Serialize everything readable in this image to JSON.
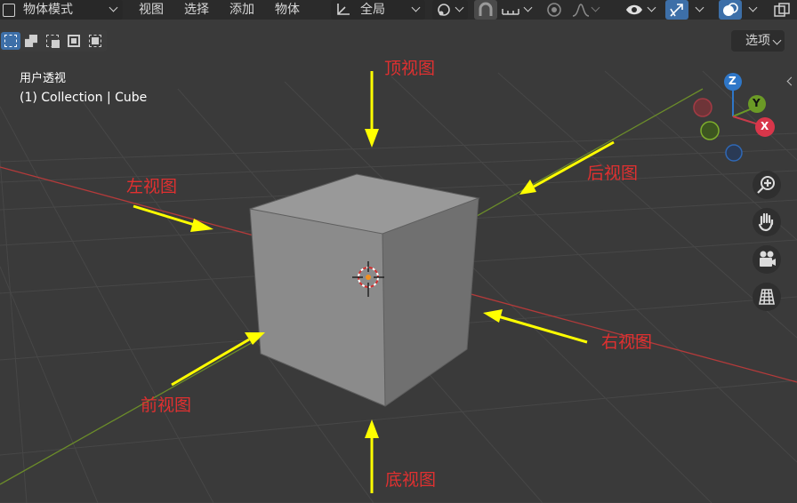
{
  "header": {
    "mode_label": "物体模式",
    "menu": [
      "视图",
      "选择",
      "添加",
      "物体"
    ],
    "orientation_label": "全局",
    "options_label": "选项"
  },
  "overlay": {
    "view_name": "用户透视",
    "collection_label": "(1) Collection | Cube"
  },
  "gizmo": {
    "x_label": "X",
    "y_label": "Y",
    "z_label": "Z"
  },
  "annotations": {
    "top": "顶视图",
    "back": "后视图",
    "left": "左视图",
    "right": "右视图",
    "front": "前视图",
    "bottom": "底视图"
  },
  "colors": {
    "background": "#3a3a3a",
    "x_axis": "#b43a3a",
    "y_axis": "#6b8c2a",
    "annotation_text": "#e03030",
    "arrow": "#ffff00",
    "selected_button": "#3d6fa8"
  },
  "icons": [
    "object-mode-icon",
    "transform-pivot-icon",
    "link-icon",
    "snap-icon",
    "increment-icon",
    "proportional-icon",
    "falloff-icon",
    "visibility-icon",
    "gizmo-icon",
    "overlay-icon",
    "xray-icon",
    "zoom-icon",
    "hand-icon",
    "camera-icon",
    "grid-icon"
  ]
}
